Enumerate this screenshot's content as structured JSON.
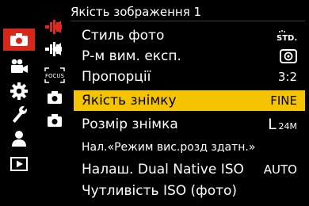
{
  "header": {
    "title": "Якість зображення 1"
  },
  "left_rail": {
    "items": [
      {
        "icon": "camera-icon",
        "active": true
      },
      {
        "icon": "video-camera-icon",
        "active": false
      },
      {
        "icon": "gear-icon",
        "active": false
      },
      {
        "icon": "wrench-icon",
        "active": false
      },
      {
        "icon": "my-menu-person-icon",
        "active": false
      },
      {
        "icon": "playback-icon",
        "active": false
      }
    ],
    "accent_color": "#d8261b"
  },
  "sub_rail": {
    "items": [
      {
        "icon": "image-quality-red-icon",
        "active": true
      },
      {
        "icon": "image-quality-icon",
        "active": false
      },
      {
        "icon": "focus-icon",
        "label": "FOCUS",
        "active": false
      },
      {
        "icon": "camera-page-icon",
        "active": false
      },
      {
        "icon": "camera-page-icon",
        "active": false
      }
    ]
  },
  "menu": {
    "items": [
      {
        "label": "Стиль фото",
        "value": "STD."
      },
      {
        "label": "Р-м вим. експ.",
        "value": ""
      },
      {
        "label": "Пропорції",
        "value": "3:2"
      },
      {
        "label": "Якість знімку",
        "value": "FINE",
        "selected": true
      },
      {
        "label": "Розмір знімка",
        "value_main": "L",
        "value_sub": "24M"
      },
      {
        "label": "Нал.«Режим вис.розд здатн.»",
        "value": ""
      },
      {
        "label": "Налаш. Dual Native ISO",
        "value": "AUTO"
      },
      {
        "label": "Чутливість ISO (фото)",
        "value": ""
      }
    ],
    "highlight_color": "#f5c400"
  }
}
